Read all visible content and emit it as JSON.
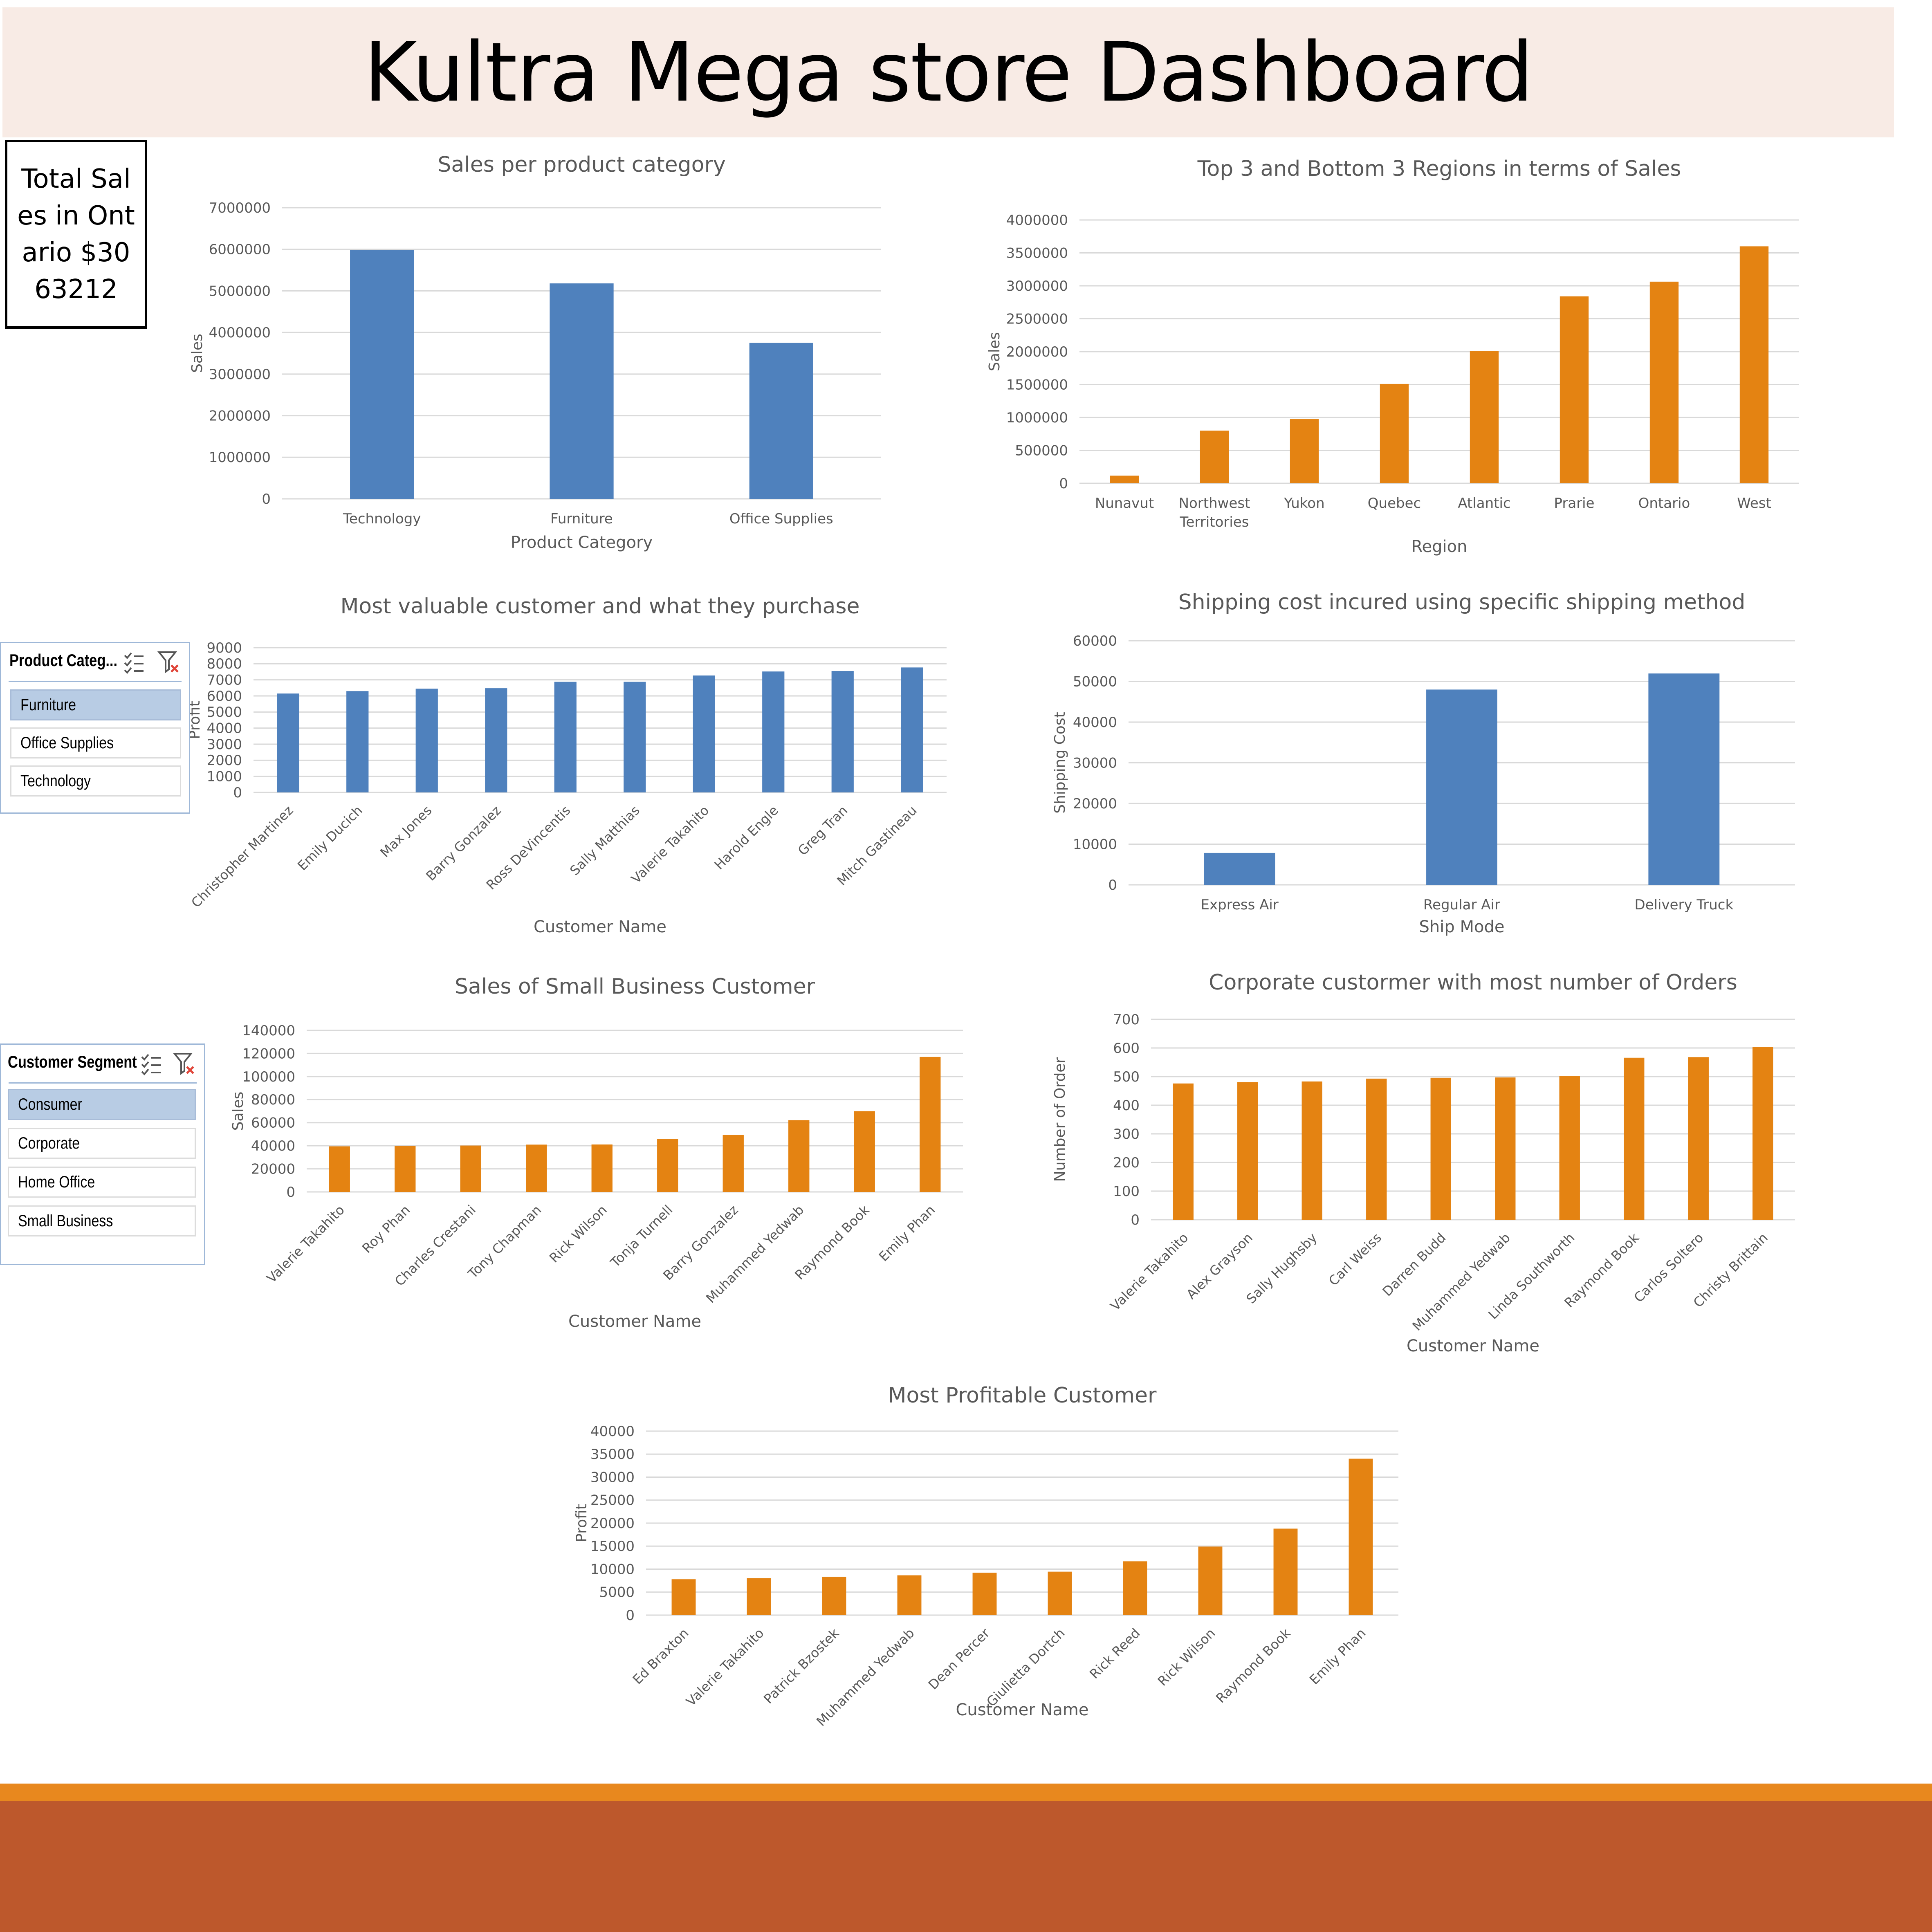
{
  "dashboard": {
    "title": "Kultra Mega store Dashboard",
    "kpi_text": "Total Sales in Ontario $3063212"
  },
  "slicers": {
    "product_category": {
      "header": "Product Categ...",
      "items": [
        {
          "label": "Furniture",
          "selected": true
        },
        {
          "label": "Office Supplies",
          "selected": false
        },
        {
          "label": "Technology",
          "selected": false
        }
      ]
    },
    "customer_segment": {
      "header": "Customer Segment",
      "items": [
        {
          "label": "Consumer",
          "selected": true
        },
        {
          "label": "Corporate",
          "selected": false
        },
        {
          "label": "Home Office",
          "selected": false
        },
        {
          "label": "Small Business",
          "selected": false
        }
      ]
    }
  },
  "colors": {
    "blue": "#4f81bd",
    "orange": "#e48312",
    "gridline": "#d9d9d9",
    "text": "#595959"
  },
  "chart_data": [
    {
      "type": "bar",
      "title": "Sales per product category",
      "xlabel": "Product Category",
      "ylabel": "Sales",
      "categories": [
        "Technology",
        "Furniture",
        "Office Supplies"
      ],
      "values": [
        5980000,
        5180000,
        3750000
      ],
      "ylim": [
        0,
        7000000
      ],
      "yticks": [
        0,
        1000000,
        2000000,
        3000000,
        4000000,
        5000000,
        6000000,
        7000000
      ],
      "color": "#4f81bd",
      "grid": true
    },
    {
      "type": "bar",
      "title": "Top 3 and Bottom 3 Regions in terms of Sales",
      "xlabel": "Region",
      "ylabel": "Sales",
      "categories": [
        "Nunavut",
        "Northwest Territories",
        "Yukon",
        "Quebec",
        "Atlantic",
        "Prarie",
        "Ontario",
        "West"
      ],
      "values": [
        116000,
        800000,
        975000,
        1510000,
        2010000,
        2840000,
        3063212,
        3600000
      ],
      "ylim": [
        0,
        4000000
      ],
      "yticks": [
        0,
        500000,
        1000000,
        1500000,
        2000000,
        2500000,
        3000000,
        3500000,
        4000000
      ],
      "color": "#e48312",
      "grid": true
    },
    {
      "type": "bar",
      "title": "Most valuable customer and what they purchase",
      "xlabel": "Customer Name",
      "ylabel": "Profit",
      "categories": [
        "Christopher Martinez",
        "Emily Ducich",
        "Max Jones",
        "Barry Gonzalez",
        "Ross DeVincentis",
        "Sally Matthias",
        "Valerie Takahito",
        "Harold Engle",
        "Greg Tran",
        "Mitch Gastineau"
      ],
      "values": [
        6150,
        6300,
        6450,
        6480,
        6880,
        6880,
        7270,
        7520,
        7550,
        7770
      ],
      "ylim": [
        0,
        9000
      ],
      "yticks": [
        0,
        1000,
        2000,
        3000,
        4000,
        5000,
        6000,
        7000,
        8000,
        9000
      ],
      "color": "#4f81bd",
      "grid": true
    },
    {
      "type": "bar",
      "title": "Shipping cost incured using specific shipping method",
      "xlabel": "Ship Mode",
      "ylabel": "Shipping Cost",
      "categories": [
        "Express Air",
        "Regular Air",
        "Delivery Truck"
      ],
      "values": [
        7850,
        48000,
        51950
      ],
      "ylim": [
        0,
        60000
      ],
      "yticks": [
        0,
        10000,
        20000,
        30000,
        40000,
        50000,
        60000
      ],
      "color": "#4f81bd",
      "grid": true
    },
    {
      "type": "bar",
      "title": "Sales  of Small Business Customer",
      "xlabel": "Customer Name",
      "ylabel": "Sales",
      "categories": [
        "Valerie Takahito",
        "Roy Phan",
        "Charles Crestani",
        "Tony Chapman",
        "Rick Wilson",
        "Tonja Turnell",
        "Barry Gonzalez",
        "Muhammed Yedwab",
        "Raymond Book",
        "Emily Phan"
      ],
      "values": [
        39500,
        39800,
        40200,
        41000,
        41100,
        46000,
        49300,
        62200,
        70000,
        117000
      ],
      "ylim": [
        0,
        140000
      ],
      "yticks": [
        0,
        20000,
        40000,
        60000,
        80000,
        100000,
        120000,
        140000
      ],
      "color": "#e48312",
      "grid": true
    },
    {
      "type": "bar",
      "title": "Corporate custormer with most number of Orders",
      "xlabel": "Customer Name",
      "ylabel": "Number of Order",
      "categories": [
        "Valerie Takahito",
        "Alex Grayson",
        "Sally Hughsby",
        "Carl Weiss",
        "Darren Budd",
        "Muhammed Yedwab",
        "Linda Southworth",
        "Raymond Book",
        "Carlos Soltero",
        "Christy Brittain"
      ],
      "values": [
        476,
        481,
        483,
        493,
        496,
        497,
        502,
        566,
        568,
        604
      ],
      "ylim": [
        0,
        700
      ],
      "yticks": [
        0,
        100,
        200,
        300,
        400,
        500,
        600,
        700
      ],
      "color": "#e48312",
      "grid": true
    },
    {
      "type": "bar",
      "title": "Most Profitable Customer",
      "xlabel": "Customer Name",
      "ylabel": "Profit",
      "categories": [
        "Ed Braxton",
        "Valerie Takahito",
        "Patrick Bzostek",
        "Muhammed Yedwab",
        "Dean Percer",
        "Giulietta Dortch",
        "Rick Reed",
        "Rick Wilson",
        "Raymond Book",
        "Emily Phan"
      ],
      "values": [
        7800,
        8000,
        8300,
        8650,
        9200,
        9450,
        11700,
        14900,
        18800,
        34000
      ],
      "ylim": [
        0,
        40000
      ],
      "yticks": [
        0,
        5000,
        10000,
        15000,
        20000,
        25000,
        30000,
        35000,
        40000
      ],
      "color": "#e48312",
      "grid": true
    }
  ]
}
